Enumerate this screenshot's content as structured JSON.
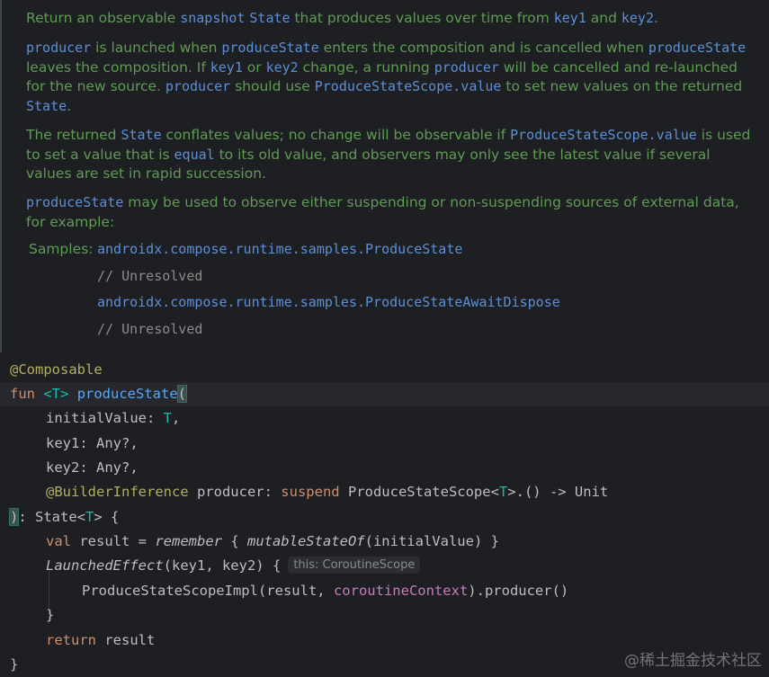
{
  "doc": {
    "p1": {
      "a": "Return an observable ",
      "b": "snapshot",
      "c": " ",
      "d": "State",
      "e": " that produces values over time from ",
      "f": "key1",
      "g": " and ",
      "h": "key2",
      "i": "."
    },
    "p2": {
      "a": "producer",
      "b": " is launched when ",
      "c": "produceState",
      "d": " enters the composition and is cancelled when ",
      "e": "produceState",
      "f": " leaves the composition. If ",
      "g": "key1",
      "h": " or ",
      "i": "key2",
      "j": " change, a running ",
      "k": "producer",
      "l": " will be cancelled and re-launched for the new source. ",
      "m": "producer",
      "n": " should use ",
      "o": "ProduceStateScope.value",
      "p": " to set new values on the returned ",
      "q": "State",
      "r": "."
    },
    "p3": {
      "a": "The returned ",
      "b": "State",
      "c": " conflates values; no change will be observable if ",
      "d": "ProduceStateScope.value",
      "e": " is used to set a value that is ",
      "f": "equal",
      "g": " to its old value, and observers may only see the latest value if several values are set in rapid succession."
    },
    "p4": {
      "a": "produceState",
      "b": " may be used to observe either suspending or non-suspending sources of external data, for example:"
    },
    "samples_label": "Samples:",
    "samples": [
      {
        "link": "androidx.compose.runtime.samples.ProduceState",
        "comment": "// Unresolved"
      },
      {
        "link": "androidx.compose.runtime.samples.ProduceStateAwaitDispose",
        "comment": "// Unresolved"
      }
    ]
  },
  "code": {
    "annotation": "@Composable",
    "fun_kw": "fun",
    "type_param": "<T>",
    "fn_name": "produceState",
    "open_paren": "(",
    "p1_name": "initialValue: ",
    "p1_type": "T",
    "p1_comma": ",",
    "p2": "key1: Any?,",
    "p3": "key2: Any?,",
    "p4_ann": "@BuilderInference",
    "p4_name": " producer: ",
    "p4_suspend": "suspend",
    "p4_type_a": " ProduceStateScope<",
    "p4_type_t": "T",
    "p4_type_b": ">.() -> Unit",
    "close_a": "): State<",
    "close_t": "T",
    "close_b": "> {",
    "l7_val": "val",
    "l7_a": " result = ",
    "l7_remember": "remember",
    "l7_b": " { ",
    "l7_mso": "mutableStateOf",
    "l7_c": "(initialValue) }",
    "l8_fn": "LaunchedEffect",
    "l8_args": "(key1, key2) {",
    "l8_hint": "this: CoroutineScope",
    "l9_a": "ProduceStateScopeImpl(result, ",
    "l9_ctx": "coroutineContext",
    "l9_b": ").producer()",
    "l10": "}",
    "l11_kw": "return",
    "l11_rest": " result",
    "l12": "}"
  },
  "watermark": "@稀土掘金技术社区"
}
